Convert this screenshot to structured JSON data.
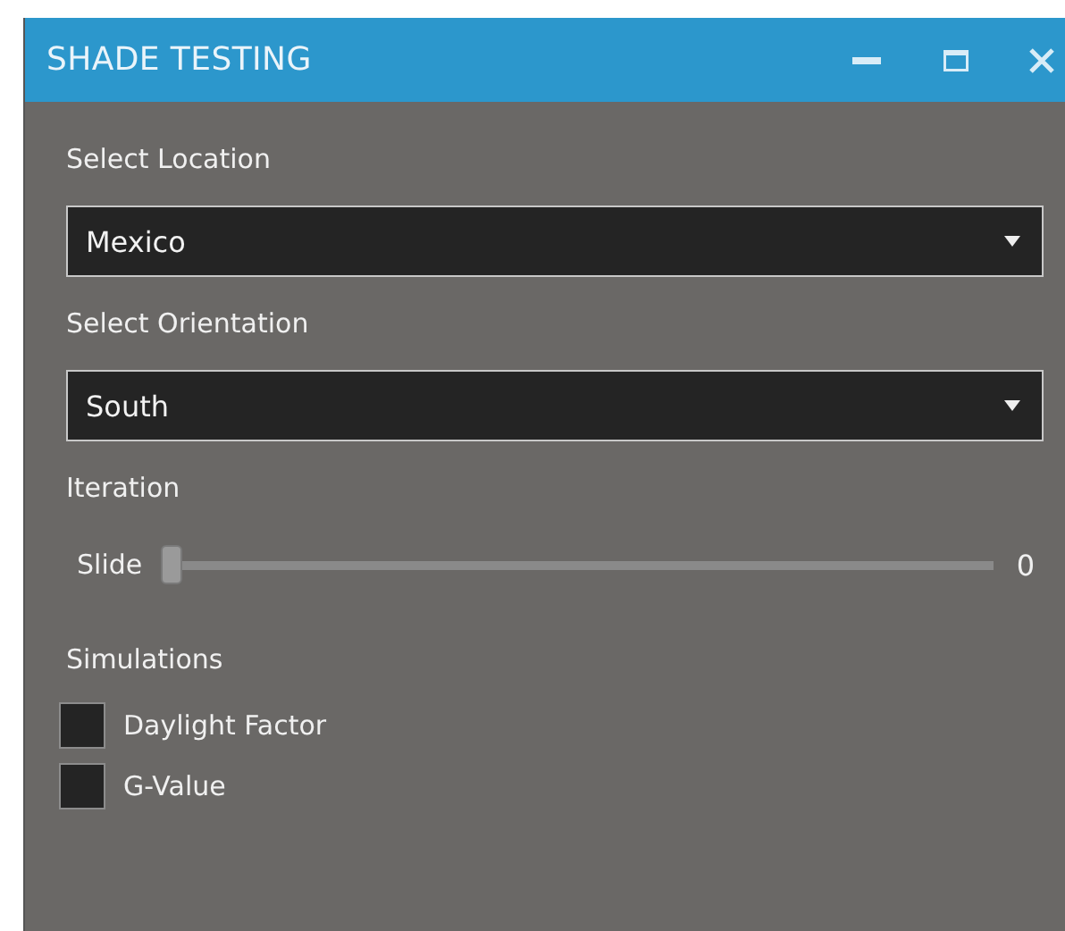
{
  "window": {
    "title": "SHADE TESTING"
  },
  "location": {
    "label": "Select Location",
    "value": "Mexico"
  },
  "orientation": {
    "label": "Select Orientation",
    "value": "South"
  },
  "iteration": {
    "label": "Iteration",
    "slider_label": "Slide",
    "level": 0,
    "reading": "0"
  },
  "simulations": {
    "label": "Simulations",
    "options": [
      {
        "label": "Daylight Factor",
        "checked": false
      },
      {
        "label": "G-Value",
        "checked": false
      }
    ]
  }
}
